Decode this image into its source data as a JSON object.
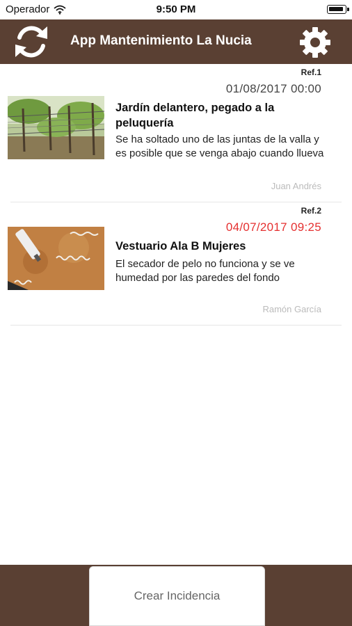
{
  "status_bar": {
    "carrier": "Operador",
    "time": "9:50 PM",
    "icons": [
      "wifi-icon",
      "battery-icon"
    ]
  },
  "nav": {
    "title": "App Mantenimiento La Nucia",
    "left_icon": "refresh-icon",
    "right_icon": "gear-icon"
  },
  "colors": {
    "brand": "#5a4033",
    "date_alert": "#e53030",
    "author_text": "#bbbbbb"
  },
  "incidents": [
    {
      "ref": "Ref.1",
      "date": "01/08/2017 00:00",
      "title": "Jardín delantero, pegado a la peluquería",
      "description": "Se ha soltado uno de las juntas de la valla y es posible que se venga abajo cuando llueva",
      "author": "Juan Andrés",
      "thumbnail": "garden-fence-photo"
    },
    {
      "ref": "Ref.2",
      "date": "04/07/2017 09:25",
      "title": "Vestuario Ala B Mujeres",
      "description": "El secador de pelo no funciona y se ve humedad por las paredes del fondo",
      "author": "Ramón García",
      "thumbnail": "damp-wall-photo"
    }
  ],
  "footer": {
    "create_label": "Crear Incidencia"
  }
}
